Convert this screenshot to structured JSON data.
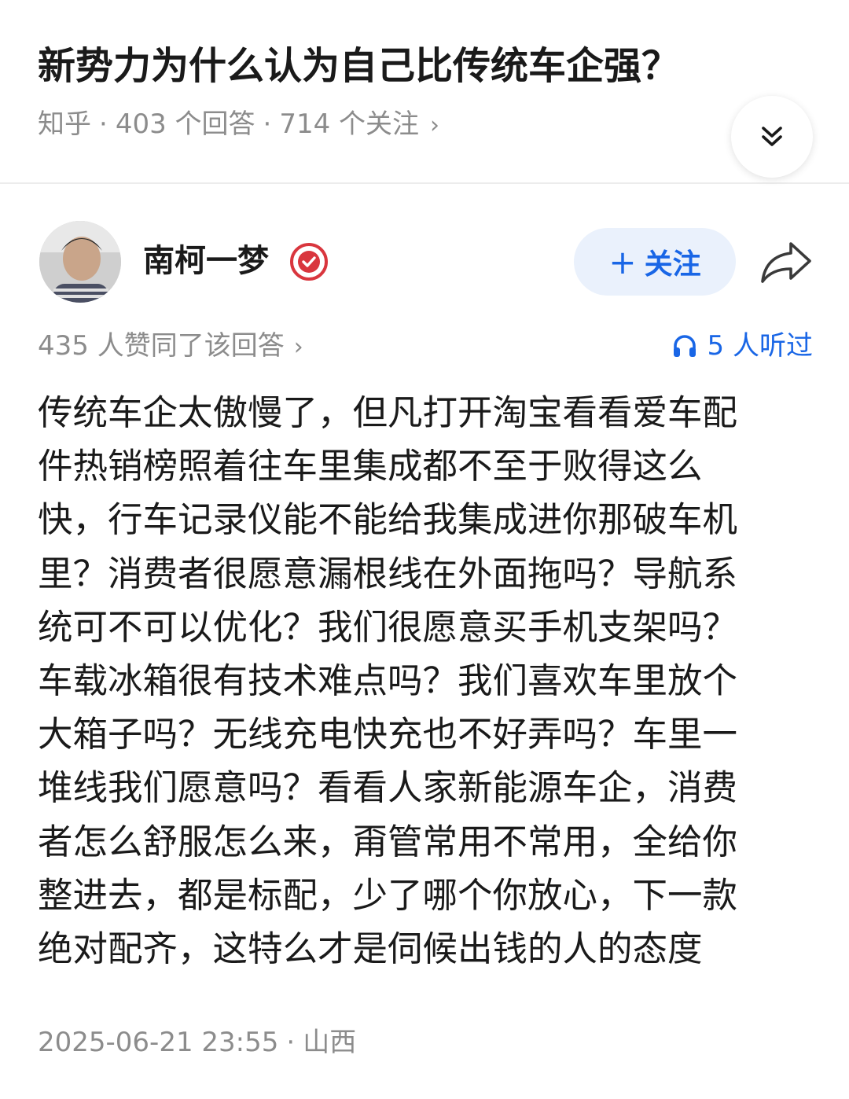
{
  "question": {
    "title": "新势力为什么认为自己比传统车企强？",
    "source": "知乎",
    "answers_count": "403 个回答",
    "followers_count": "714 个关注",
    "separator": "·",
    "meta_chevron": "›"
  },
  "author": {
    "name": "南柯一梦",
    "follow_plus": "+",
    "follow_label": "关注"
  },
  "stats": {
    "votes": "435 人赞同了该回答",
    "chevron": "›",
    "listened": "5 人听过"
  },
  "answer": {
    "lines": [
      "传统车企太傲慢了，但凡打开淘宝看看爱车配",
      "件热销榜照着往车里集成都不至于败得这么",
      "快，行车记录仪能不能给我集成进你那破车机",
      "里？消费者很愿意漏根线在外面拖吗？导航系",
      "统可不可以优化？我们很愿意买手机支架吗？",
      "车载冰箱很有技术难点吗？我们喜欢车里放个",
      "大箱子吗？无线充电快充也不好弄吗？车里一",
      "堆线我们愿意吗？看看人家新能源车企，消费",
      "者怎么舒服怎么来，甭管常用不常用，全给你",
      "整进去，都是标配，少了哪个你放心，下一款",
      "绝对配齐，这特么才是伺候出钱的人的态度"
    ]
  },
  "footer": {
    "datetime": "2025-06-21 23:55",
    "separator": "·",
    "location": "山西"
  },
  "colors": {
    "accent_blue": "#1966e6",
    "follow_bg": "#eaf1fc",
    "meta_gray": "#8c8c8c",
    "badge_red": "#d9363e"
  }
}
